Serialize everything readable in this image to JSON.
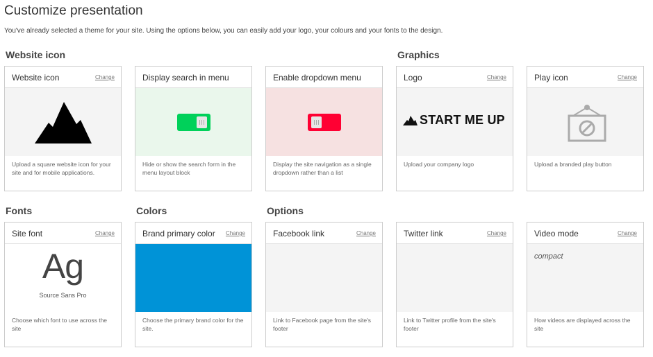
{
  "page": {
    "title": "Customize presentation",
    "subtitle": "You've already selected a theme for your site. Using the options below, you can easily add your logo, your colours and your fonts to the design."
  },
  "sections": {
    "website_icon": "Website icon",
    "graphics": "Graphics",
    "fonts": "Fonts",
    "colors": "Colors",
    "options": "Options"
  },
  "change_label": "Change",
  "cards": {
    "website_icon": {
      "title": "Website icon",
      "description": "Upload a square website icon for your site and for mobile applications.",
      "icon": "mountain-icon"
    },
    "search_menu": {
      "title": "Display search in menu",
      "description": "Hide or show the search form in the menu layout block",
      "state": "on",
      "color": "#00d15a"
    },
    "dropdown_menu": {
      "title": "Enable dropdown menu",
      "description": "Display the site navigation as a single dropdown rather than a list",
      "state": "off",
      "color": "#ff0033"
    },
    "logo": {
      "title": "Logo",
      "description": "Upload your company logo",
      "logo_text": "START ME UP"
    },
    "play_icon": {
      "title": "Play icon",
      "description": "Upload a branded play button",
      "icon": "play-frame-icon"
    },
    "site_font": {
      "title": "Site font",
      "description": "Choose which font to use across the site",
      "sample": "Ag",
      "font_name": "Source Sans Pro"
    },
    "brand_color": {
      "title": "Brand primary color",
      "description": "Choose the primary brand color for the site.",
      "color": "#0093d7"
    },
    "facebook": {
      "title": "Facebook link",
      "description": "Link to Facebook page from the site's footer"
    },
    "twitter": {
      "title": "Twitter link",
      "description": "Link to Twitter profile from the site's footer"
    },
    "video_mode": {
      "title": "Video mode",
      "value": "compact",
      "description": "How videos are displayed across the site"
    }
  }
}
